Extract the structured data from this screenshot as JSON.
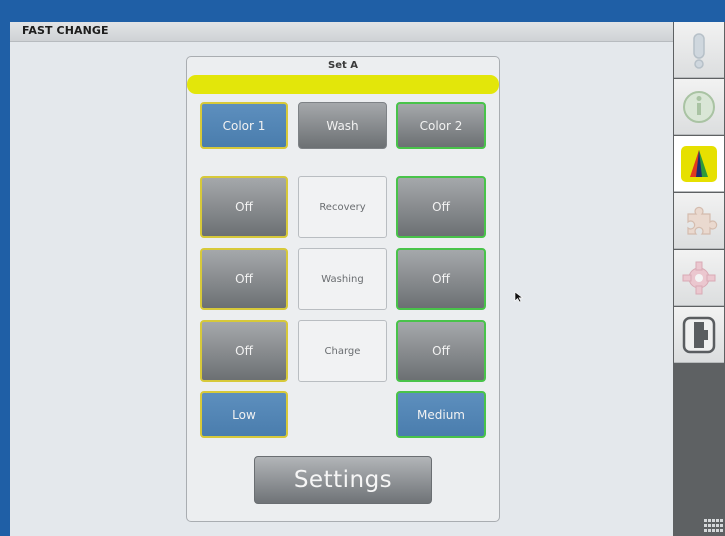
{
  "header": {
    "title": "FAST CHANGE"
  },
  "panel": {
    "set_label": "Set A",
    "top_row": {
      "color1": "Color 1",
      "wash": "Wash",
      "color2": "Color 2"
    },
    "rows": [
      {
        "left": "Off",
        "label": "Recovery",
        "right": "Off"
      },
      {
        "left": "Off",
        "label": "Washing",
        "right": "Off"
      },
      {
        "left": "Off",
        "label": "Charge",
        "right": "Off"
      }
    ],
    "bottom_row": {
      "left": "Low",
      "right": "Medium"
    },
    "settings_label": "Settings"
  },
  "sidebar": {
    "items": [
      {
        "icon": "alert-icon"
      },
      {
        "icon": "info-icon"
      },
      {
        "icon": "color-change-icon",
        "active": true
      },
      {
        "icon": "puzzle-icon"
      },
      {
        "icon": "gear-icon"
      },
      {
        "icon": "profile-icon"
      }
    ]
  },
  "colors": {
    "accent_yellow": "#e3e60a",
    "button_blue": "#4f82b2",
    "border_green": "#49c34a",
    "border_yellow": "#d7c93a",
    "frame_blue": "#1f5fa6"
  }
}
